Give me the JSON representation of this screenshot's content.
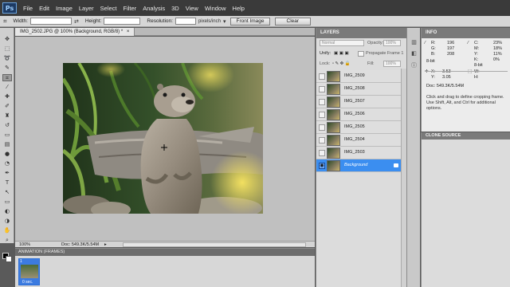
{
  "menu": [
    "File",
    "Edit",
    "Image",
    "Layer",
    "Select",
    "Filter",
    "Analysis",
    "3D",
    "View",
    "Window",
    "Help"
  ],
  "app_logo": "Ps",
  "options": {
    "width_label": "Width:",
    "height_label": "Height:",
    "resolution_label": "Resolution:",
    "resolution_unit": "pixels/inch",
    "front_image": "Front Image",
    "clear": "Clear"
  },
  "document": {
    "tab_title": "IMG_2502.JPG @ 100% (Background, RGB/8) *",
    "zoom": "100%",
    "doc_info": "Doc: 549.3K/5.54M"
  },
  "animation": {
    "title": "ANIMATION (FRAMES)",
    "frame_number": "1",
    "frame_time": "0 sec."
  },
  "layers": {
    "title": "LAYERS",
    "blend_mode": "Normal",
    "opacity_label": "Opacity:",
    "opacity_value": "100%",
    "unify_label": "Unify:",
    "propagate_label": "Propagate Frame 1",
    "lock_label": "Lock:",
    "fill_label": "Fill:",
    "fill_value": "100%",
    "items": [
      {
        "name": "IMG_2509"
      },
      {
        "name": "IMG_2508"
      },
      {
        "name": "IMG_2507"
      },
      {
        "name": "IMG_2506"
      },
      {
        "name": "IMG_2505"
      },
      {
        "name": "IMG_2504"
      },
      {
        "name": "IMG_2503"
      },
      {
        "name": "Background",
        "selected": true
      }
    ]
  },
  "info": {
    "title": "INFO",
    "r_label": "R:",
    "r_value": "196",
    "g_label": "G:",
    "g_value": "197",
    "b_label": "B:",
    "b_value": "208",
    "bit_left": "8-bit",
    "c_label": "C:",
    "c_value": "23%",
    "m_label": "M:",
    "m_value": "18%",
    "y_label": "Y:",
    "y_value": "11%",
    "k_label": "K:",
    "k_value": "0%",
    "bit_right": "8-bit",
    "x_label": "X:",
    "x_value": "3.53",
    "yy_label": "Y:",
    "yy_value": "3.05",
    "w_label": "W:",
    "h_label": "H:",
    "doc": "Doc: 549.3K/5.54M",
    "hint": "Click and drag to define cropping frame. Use Shift, Alt, and Ctrl for additional options."
  },
  "clone_source": {
    "title": "CLONE SOURCE"
  },
  "colors": {
    "menubar": "#3a3a3a",
    "selection_blue": "#3b8ef0",
    "canvas_bg": "#c0c0c0"
  }
}
